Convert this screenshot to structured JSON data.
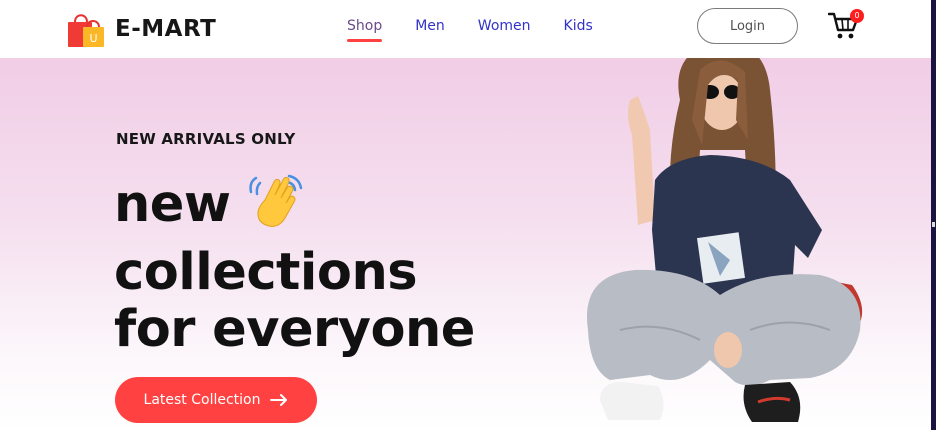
{
  "brand": {
    "name": "E-MART",
    "logo_icon": "shopping-bag-icon",
    "logo_letter": "U"
  },
  "nav": {
    "items": [
      {
        "label": "Shop",
        "active": true
      },
      {
        "label": "Men",
        "active": false
      },
      {
        "label": "Women",
        "active": false
      },
      {
        "label": "Kids",
        "active": false
      }
    ]
  },
  "header": {
    "login_label": "Login",
    "cart_icon": "cart-icon",
    "cart_count": "0"
  },
  "hero": {
    "tagline": "NEW ARRIVALS ONLY",
    "headline": {
      "line1": "new",
      "line2": "collections",
      "line3": "for everyone"
    },
    "wave_icon": "waving-hand-icon",
    "cta_label": "Latest Collection",
    "cta_icon": "arrow-right-icon",
    "image": "model-photo"
  },
  "colors": {
    "accent": "#ff4141",
    "nav_link": "#3232c8",
    "hero_top": "#f1cde6",
    "text": "#171717"
  }
}
